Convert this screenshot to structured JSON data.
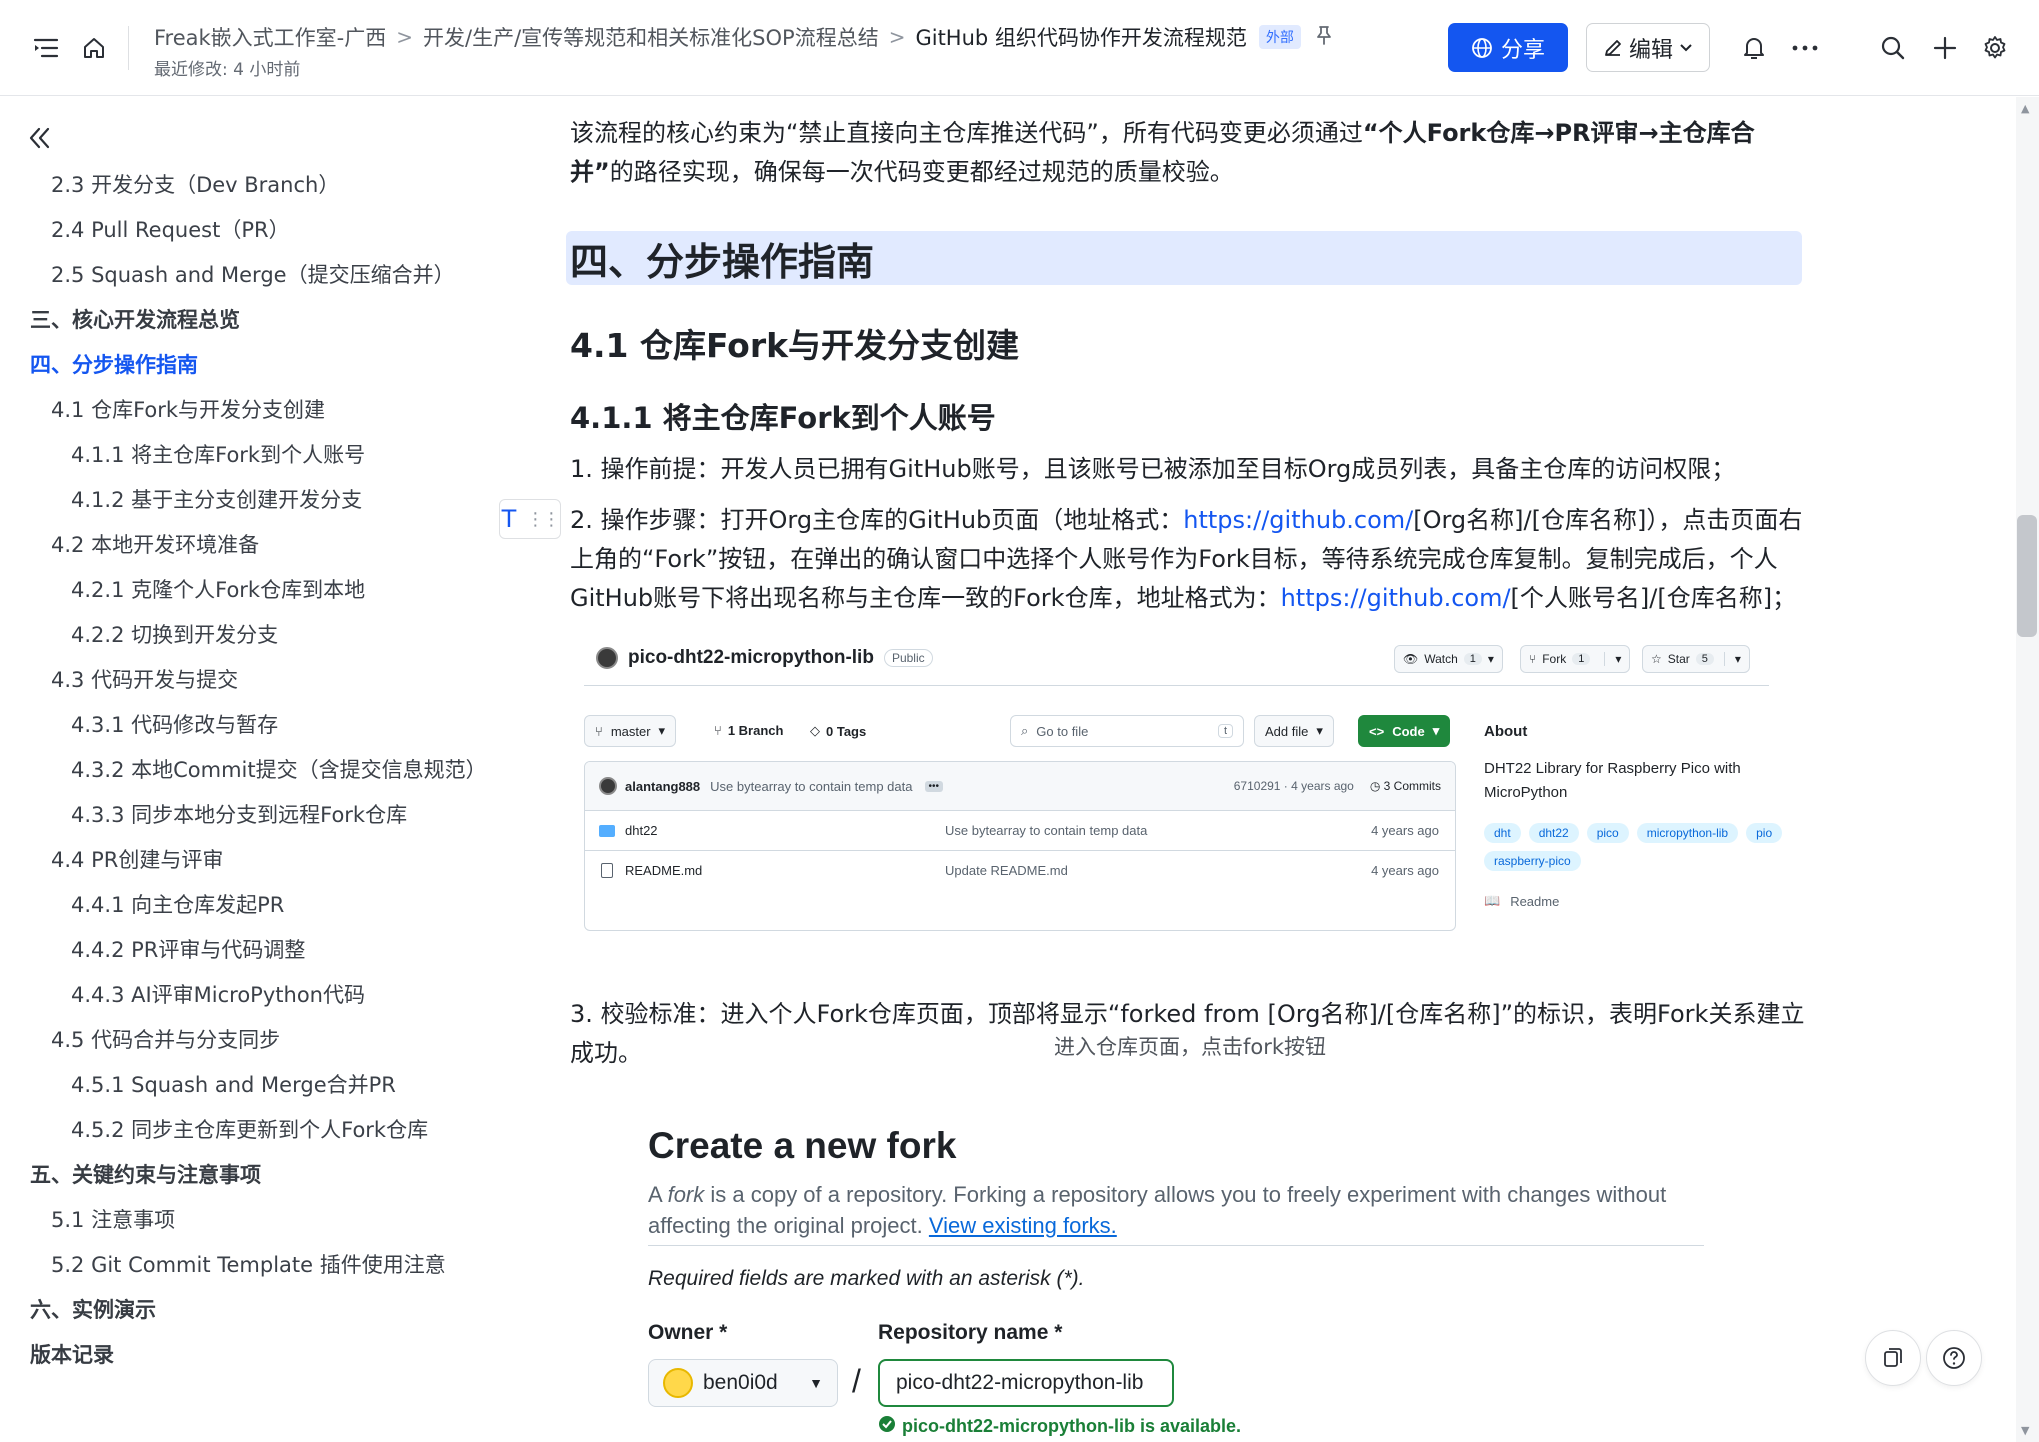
{
  "header": {
    "breadcrumbs": [
      "Freak嵌入式工作室-广西",
      "开发/生产/宣传等规范和相关标准化SOP流程总结",
      "GitHub 组织代码协作开发流程规范"
    ],
    "badge": "外部",
    "last_modified": "最近修改: 4 小时前",
    "share_label": "分享",
    "edit_label": "编辑"
  },
  "toc": [
    {
      "label": "2.3 开发分支（Dev Branch）",
      "level": 2
    },
    {
      "label": "2.4 Pull Request（PR）",
      "level": 2
    },
    {
      "label": "2.5 Squash and Merge（提交压缩合并）",
      "level": 2
    },
    {
      "label": "三、核心开发流程总览",
      "level": 1
    },
    {
      "label": "四、分步操作指南",
      "level": 1,
      "active": true
    },
    {
      "label": "4.1 仓库Fork与开发分支创建",
      "level": 2
    },
    {
      "label": "4.1.1 将主仓库Fork到个人账号",
      "level": 3
    },
    {
      "label": "4.1.2 基于主分支创建开发分支",
      "level": 3
    },
    {
      "label": "4.2 本地开发环境准备",
      "level": 2
    },
    {
      "label": "4.2.1 克隆个人Fork仓库到本地",
      "level": 3
    },
    {
      "label": "4.2.2 切换到开发分支",
      "level": 3
    },
    {
      "label": "4.3 代码开发与提交",
      "level": 2
    },
    {
      "label": "4.3.1 代码修改与暂存",
      "level": 3
    },
    {
      "label": "4.3.2 本地Commit提交（含提交信息规范）",
      "level": 3
    },
    {
      "label": "4.3.3 同步本地分支到远程Fork仓库",
      "level": 3
    },
    {
      "label": "4.4 PR创建与评审",
      "level": 2
    },
    {
      "label": "4.4.1 向主仓库发起PR",
      "level": 3
    },
    {
      "label": "4.4.2 PR评审与代码调整",
      "level": 3
    },
    {
      "label": "4.4.3 AI评审MicroPython代码",
      "level": 3
    },
    {
      "label": "4.5 代码合并与分支同步",
      "level": 2
    },
    {
      "label": "4.5.1 Squash and Merge合并PR",
      "level": 3
    },
    {
      "label": "4.5.2 同步主仓库更新到个人Fork仓库",
      "level": 3
    },
    {
      "label": "五、关键约束与注意事项",
      "level": 1
    },
    {
      "label": "5.1 注意事项",
      "level": 2
    },
    {
      "label": "5.2 Git Commit Template 插件使用注意",
      "level": 2
    },
    {
      "label": "六、实例演示",
      "level": 1
    },
    {
      "label": "版本记录",
      "level": 1
    }
  ],
  "content": {
    "intro_a": "该流程的核心约束为“禁止直接向主仓库推送代码”，所有代码变更必须通过",
    "intro_b": "“个人Fork仓库→PR评审→主仓库合",
    "intro_c": "并”",
    "intro_d": "的路径实现，确保每一次代码变更都经过规范的质量校验。",
    "h1": "四、分步操作指南",
    "h2": "4.1 仓库Fork与开发分支创建",
    "h3": "4.1.1 将主仓库Fork到个人账号",
    "step1": "1. 操作前提：开发人员已拥有GitHub账号，且该账号已被添加至目标Org成员列表，具备主仓库的访问权限；",
    "step2_a": "2. 操作步骤：打开Org主仓库的GitHub页面（地址格式：",
    "step2_link1": "https://github.com/",
    "step2_b": "[Org名称]/[仓库名称]），点击页面右",
    "step2_c": "上角的“Fork”按钮，在弹出的确认窗口中选择个人账号作为Fork目标，等待系统完成仓库复制。复制完成后，个人",
    "step2_d": "GitHub账号下将出现名称与主仓库一致的Fork仓库，地址格式为：",
    "step2_link2": "https://github.com/",
    "step2_e": "[个人账号名]/[仓库名称]；",
    "caption1": "进入仓库页面，点击fork按钮",
    "step3_a": "3. 校验标准：进入个人Fork仓库页面，顶部将显示“forked from [Org名称]/[仓库名称]”的标识，表明Fork关系建立",
    "step3_b": "成功。"
  },
  "github_repo": {
    "name": "pico-dht22-micropython-lib",
    "visibility": "Public",
    "watch": "Watch",
    "watch_count": "1",
    "fork": "Fork",
    "fork_count": "1",
    "star": "Star",
    "star_count": "5",
    "branch": "master",
    "branches": "1 Branch",
    "tags": "0 Tags",
    "go_to_file": "Go to file",
    "kbd": "t",
    "add_file": "Add file",
    "code": "Code",
    "commit_author": "alantang888",
    "commit_msg": "Use bytearray to contain temp data",
    "commit_meta": "6710291 · 4 years ago",
    "commits": "3 Commits",
    "files": [
      {
        "name": "dht22",
        "msg": "Use bytearray to contain temp data",
        "age": "4 years ago",
        "type": "dir"
      },
      {
        "name": "README.md",
        "msg": "Update README.md",
        "age": "4 years ago",
        "type": "file"
      }
    ],
    "about_title": "About",
    "about_desc": "DHT22 Library for Raspberry Pico with MicroPython",
    "topics": [
      "dht",
      "dht22",
      "pico",
      "micropython-lib",
      "pio",
      "raspberry-pico"
    ],
    "readme": "Readme"
  },
  "github_fork": {
    "title": "Create a new fork",
    "desc_a": "A ",
    "desc_em": "fork",
    "desc_b": " is a copy of a repository. Forking a repository allows you to freely experiment with changes without affecting the original project. ",
    "desc_link": "View existing forks.",
    "required": "Required fields are marked with an asterisk (*).",
    "owner_label": "Owner *",
    "owner_value": "ben0i0d",
    "repo_label": "Repository name *",
    "repo_value": "pico-dht22-micropython-lib",
    "available": "pico-dht22-micropython-lib is available."
  },
  "text_tool_label": "T",
  "colors": {
    "accent": "#1456f0",
    "heading_bg": "#e1eaff",
    "gh_green": "#1f883d"
  }
}
